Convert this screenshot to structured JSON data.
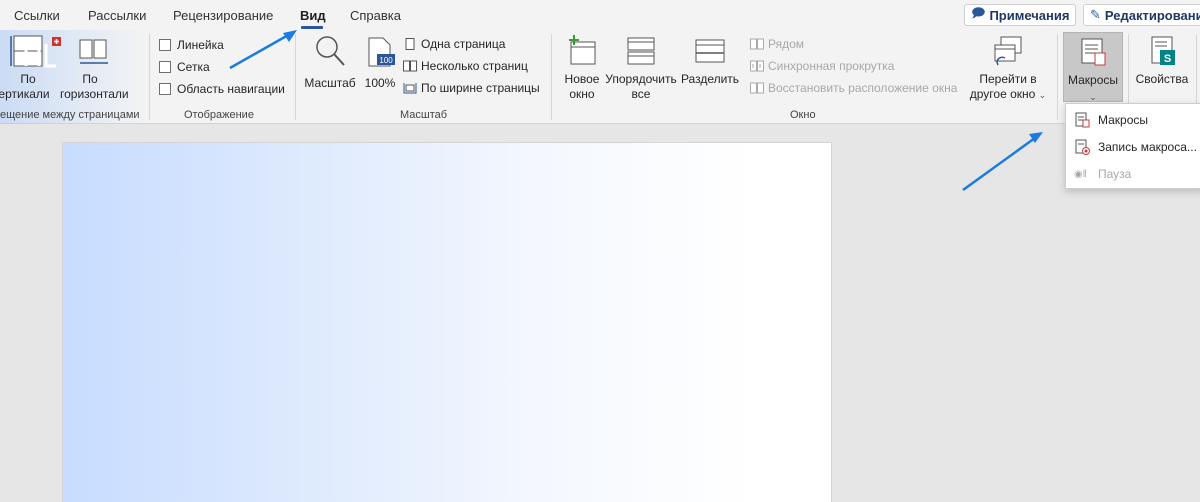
{
  "tabs": [
    "Ссылки",
    "Рассылки",
    "Рецензирование",
    "Вид",
    "Справка"
  ],
  "active_tab": "Вид",
  "top_buttons": {
    "comments": "Примечания",
    "editing": "Редактировани"
  },
  "ribbon": {
    "page_movement": {
      "vertical": [
        "По",
        "ертикали"
      ],
      "horizontal": [
        "По",
        "горизонтали"
      ],
      "label": "ещение между страницами"
    },
    "show": {
      "ruler": "Линейка",
      "grid": "Сетка",
      "nav_pane": "Область навигации",
      "label": "Отображение"
    },
    "zoom": {
      "zoom": "Масштаб",
      "hundred": "100%",
      "icon_value": "100",
      "one_page": "Одна страница",
      "multiple_pages": "Несколько страниц",
      "page_width": "По ширине страницы",
      "label": "Масштаб"
    },
    "window": {
      "new_window": [
        "Новое",
        "окно"
      ],
      "arrange_all": [
        "Упорядочить",
        "все"
      ],
      "split": "Разделить",
      "side_by_side": "Рядом",
      "sync_scroll": "Синхронная прокрутка",
      "reset_position": "Восстановить расположение окна",
      "switch_windows": [
        "Перейти в",
        "другое окно"
      ],
      "label": "Окно"
    },
    "macros": "Макросы",
    "properties": "Свойства"
  },
  "dropdown": {
    "view_macros": "Макросы",
    "record_macro": "Запись макроса...",
    "pause": "Пауза"
  },
  "colors": {
    "accent": "#2b579a",
    "arrow": "#1a7be0",
    "sharepoint": "#038387"
  }
}
